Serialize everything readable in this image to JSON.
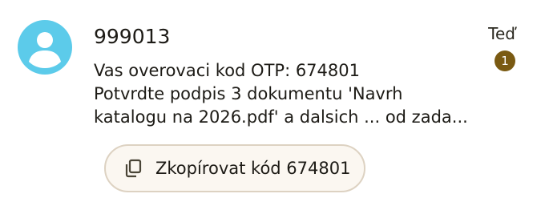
{
  "notification": {
    "avatar_icon": "person-icon",
    "sender": "999013",
    "time": "Teď",
    "badge_count": "1",
    "body_lines": [
      "Vas overovaci kod OTP: 674801",
      "Potvrdte podpis 3 dokumentu 'Navrh",
      "katalogu na 2026.pdf' a dalsich ... od zada..."
    ],
    "action": {
      "icon": "copy-icon",
      "label": "Zkopírovat kód 674801"
    }
  },
  "colors": {
    "avatar_bg": "#5ccbea",
    "badge_bg": "#7a5a12",
    "button_bg": "#fbf7f1",
    "button_border": "#ddd2c2"
  }
}
